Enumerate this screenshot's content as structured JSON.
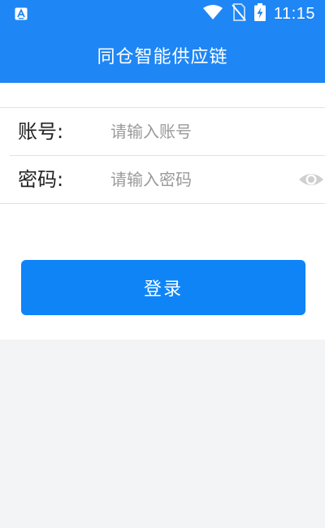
{
  "status_bar": {
    "time": "11:15",
    "icons": [
      "app-notification-icon",
      "wifi-icon",
      "no-sim-icon",
      "battery-charging-icon"
    ]
  },
  "header": {
    "title": "同仓智能供应链"
  },
  "form": {
    "account": {
      "label": "账号:",
      "placeholder": "请输入账号",
      "value": ""
    },
    "password": {
      "label": "密码:",
      "placeholder": "请输入密码",
      "value": "",
      "toggle_icon": "eye-icon"
    },
    "login_label": "登录"
  },
  "colors": {
    "primary": "#1f86f5",
    "button": "#0f84f7",
    "background": "#f3f4f6",
    "panel": "#ffffff",
    "placeholder": "#9a9a9a"
  }
}
